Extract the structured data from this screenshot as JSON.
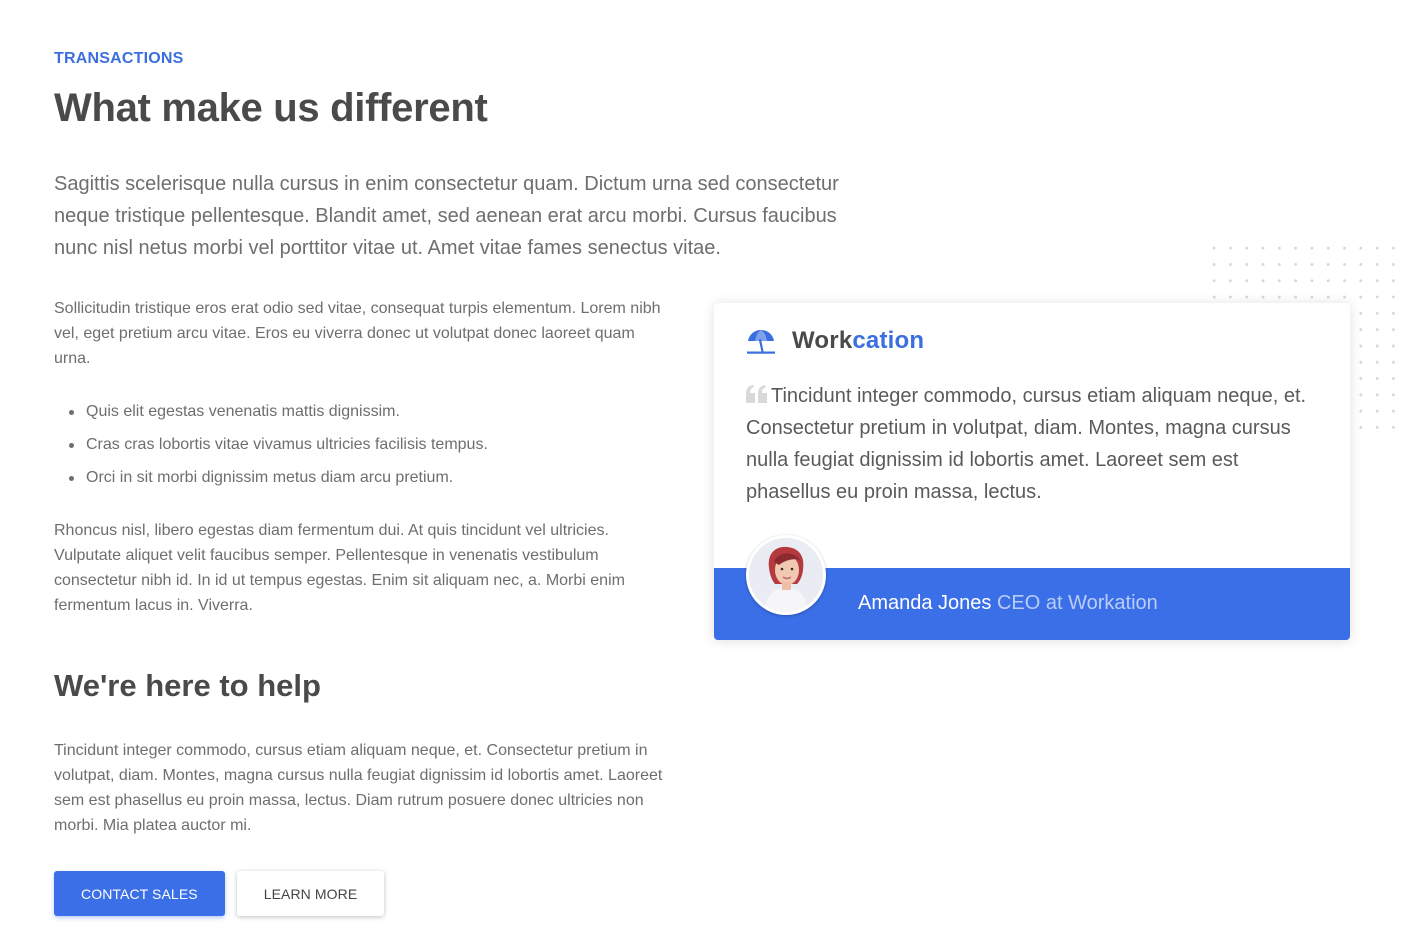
{
  "section": {
    "eyebrow": "Transactions",
    "title": "What make us different",
    "lead": "Sagittis scelerisque nulla cursus in enim consectetur quam. Dictum urna sed consectetur neque tristique pellentesque. Blandit amet, sed aenean erat arcu morbi. Cursus faucibus nunc nisl netus morbi vel porttitor vitae ut. Amet vitae fames senectus vitae."
  },
  "content": {
    "paragraph1": "Sollicitudin tristique eros erat odio sed vitae, consequat turpis elementum. Lorem nibh vel, eget pretium arcu vitae. Eros eu viverra donec ut volutpat donec laoreet quam urna.",
    "bullets": [
      "Quis elit egestas venenatis mattis dignissim.",
      "Cras cras lobortis vitae vivamus ultricies facilisis tempus.",
      "Orci in sit morbi dignissim metus diam arcu pretium."
    ],
    "paragraph2": "Rhoncus nisl, libero egestas diam fermentum dui. At quis tincidunt vel ultricies. Vulputate aliquet velit faucibus semper. Pellentesque in venenatis vestibulum consectetur nibh id. In id ut tempus egestas. Enim sit aliquam nec, a. Morbi enim fermentum lacus in. Viverra.",
    "subheading": "We're here to help",
    "paragraph3": "Tincidunt integer commodo, cursus etiam aliquam neque, et. Consectetur pretium in volutpat, diam. Montes, magna cursus nulla feugiat dignissim id lobortis amet. Laoreet sem est phasellus eu proin massa, lectus. Diam rutrum posuere donec ultricies non morbi. Mia platea auctor mi."
  },
  "buttons": {
    "primary_label": "Contact sales",
    "secondary_label": "Learn more"
  },
  "testimonial": {
    "brand_part1": "Work",
    "brand_part2": "cation",
    "brand_icon": "umbrella-icon",
    "quote_icon": "quote-icon",
    "quote": "Tincidunt integer commodo, cursus etiam aliquam neque, et. Consectetur pretium in volutpat, diam. Montes, magna cursus nulla feugiat dignissim id lobortis amet. Laoreet sem est phasellus eu proin massa, lectus.",
    "author_name": "Amanda Jones",
    "author_role": "CEO at Workation"
  },
  "colors": {
    "accent": "#3b6fe8",
    "eyebrow": "#3b6fe0",
    "heading": "#4a4a4a",
    "body_text": "#6e6e6e"
  }
}
